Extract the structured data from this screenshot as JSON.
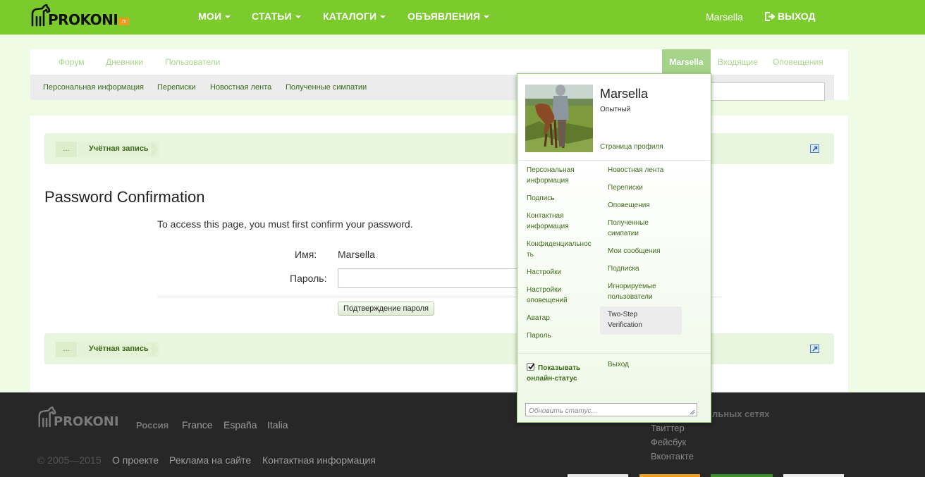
{
  "header": {
    "logo_text": "PROKONI",
    "logo_suffix": ".ru",
    "nav": [
      "МОИ",
      "СТАТЬИ",
      "КАТАЛОГИ",
      "ОБЪЯВЛЕНИЯ"
    ],
    "username": "Marsella",
    "logout": "ВЫХОД",
    "accent_color": "#7ccb2c"
  },
  "tabs": {
    "left": [
      "Форум",
      "Дневники",
      "Пользователи"
    ],
    "active": "Marsella",
    "right": [
      "Входящие",
      "Оповещения"
    ]
  },
  "subnav": [
    "Персональная информация",
    "Переписки",
    "Новостная лента",
    "Полученные симпатии"
  ],
  "breadcrumb": {
    "home": "...",
    "current": "Учётная запись"
  },
  "form": {
    "title": "Password Confirmation",
    "intro": "To access this page, you must first confirm your password.",
    "name_label": "Имя:",
    "name_value": "Marsella",
    "password_label": "Пароль:",
    "password_value": "",
    "submit": "Подтверждение пароля"
  },
  "popup": {
    "name": "Marsella",
    "rank": "Опытный",
    "profile_link": "Страница профиля",
    "left_col": [
      "Персональная информация",
      "Подпись",
      "Контактная информация",
      "Конфиденциальность",
      "Настройки",
      "Настройки оповещений",
      "Аватар",
      "Пароль"
    ],
    "right_col": [
      "Новостная лента",
      "Переписки",
      "Оповещения",
      "Полученные симпатии",
      "Мои сообщения",
      "Подписка",
      "Игнорируемые пользователи",
      "Two-Step Verification"
    ],
    "online_label": "Показывать онлайн-статус",
    "online_checked": true,
    "logout": "Выход",
    "status_placeholder": "Обновить статус..."
  },
  "footer": {
    "logo_text": "PROKONI",
    "languages": [
      "Россия",
      "France",
      "España",
      "Italia"
    ],
    "copyright": "© 2005—2015",
    "links": [
      "О проекте",
      "Реклама на сайте",
      "Контактная информация"
    ],
    "social_heading": "льных сетях",
    "social": [
      "Твиттер",
      "Фейсбук",
      "Вконтакте"
    ]
  }
}
